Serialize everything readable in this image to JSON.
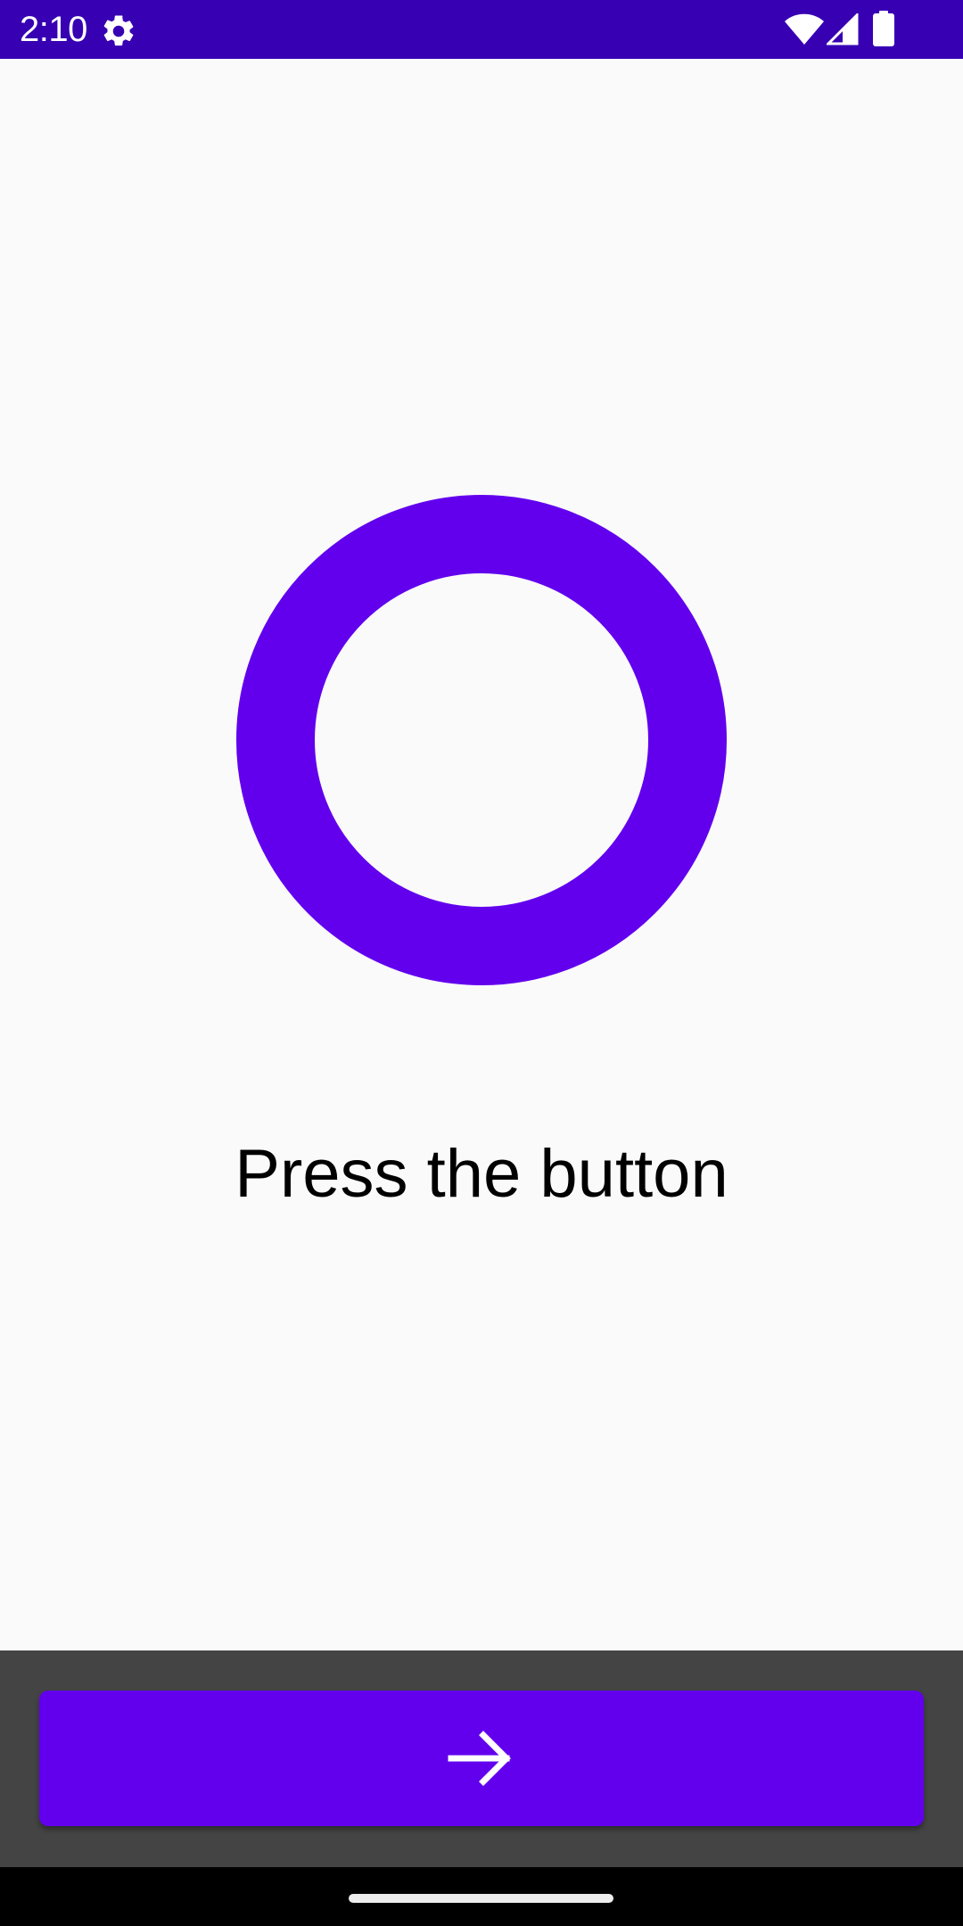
{
  "status_bar": {
    "time": "2:10",
    "background": "#3700B3",
    "icons": [
      "gear-icon",
      "wifi-icon",
      "cell-signal-icon",
      "battery-icon"
    ]
  },
  "main": {
    "ring_color": "#6200EE",
    "prompt": "Press the button"
  },
  "bottom": {
    "panel_color": "#444444",
    "button": {
      "icon": "arrow-right-icon",
      "color": "#6200EE"
    }
  },
  "nav": {
    "handle": "home-handle"
  }
}
